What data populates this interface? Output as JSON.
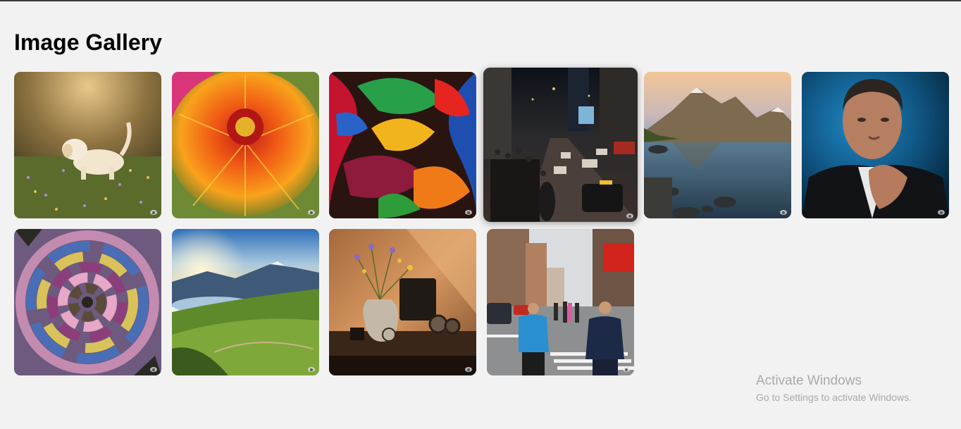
{
  "page": {
    "title": "Image Gallery"
  },
  "gallery": {
    "images": [
      {
        "name": "puppy-in-meadow-image"
      },
      {
        "name": "orange-zinnia-flower-image"
      },
      {
        "name": "abstract-swirl-painting-image"
      },
      {
        "name": "night-city-street-image"
      },
      {
        "name": "mountain-lake-image"
      },
      {
        "name": "man-portrait-image"
      },
      {
        "name": "spiral-abstract-image"
      },
      {
        "name": "valley-sunrise-image"
      },
      {
        "name": "still-life-vase-image"
      },
      {
        "name": "city-street-pedestrians-image"
      }
    ],
    "badge_icon": "eye-icon"
  },
  "watermark": {
    "title": "Activate Windows",
    "subtitle": "Go to Settings to activate Windows."
  }
}
